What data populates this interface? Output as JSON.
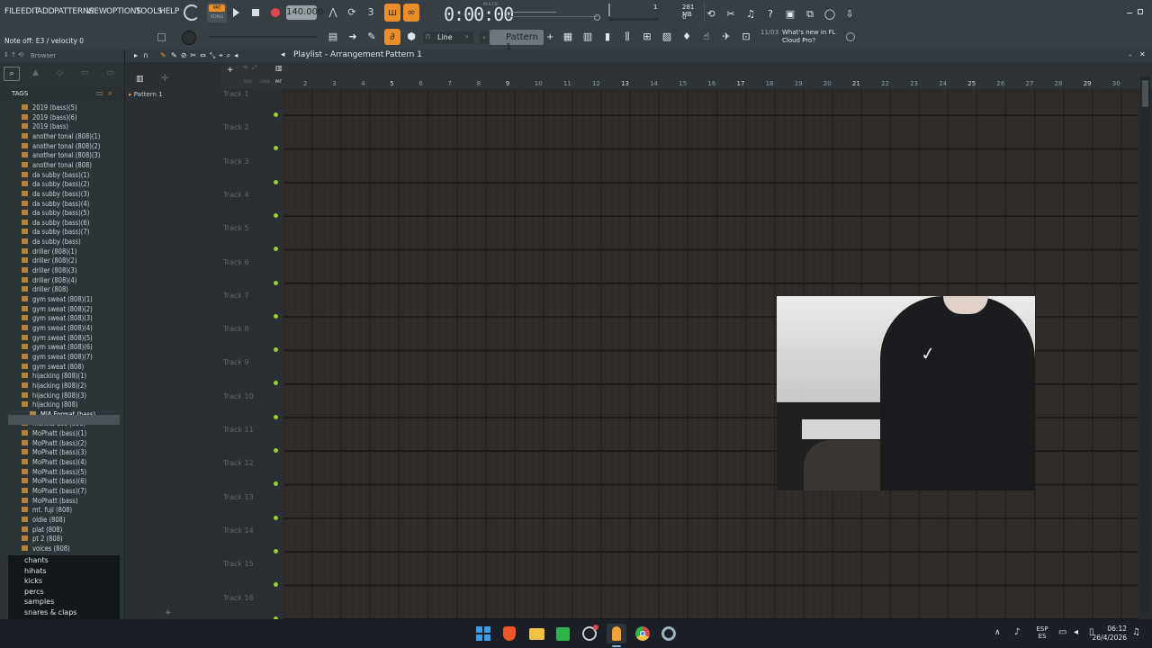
{
  "menu": {
    "items": [
      "FILE",
      "EDIT",
      "ADD",
      "PATTERNS",
      "VIEW",
      "OPTIONS",
      "TOOLS",
      "HELP"
    ]
  },
  "transport": {
    "mode_top": "PAT",
    "mode_bottom": "SONG",
    "tempo": "140.000",
    "time": "0:00:00",
    "time_label": "M:S:CS",
    "cpu_top": "1",
    "cpu_bottom": "0",
    "mem": "281 MB",
    "mem_bottom": "0"
  },
  "hint_bar": "Note off: E3 / velocity 0",
  "snap": "Line",
  "pattern_selector": "Pattern 1",
  "news": {
    "date": "11/03",
    "text": "What's new in FL Cloud Pro?"
  },
  "browser": {
    "title": "Browser",
    "tags_label": "TAGS",
    "items": [
      "2019 (bass)(5)",
      "2019 (bass)(6)",
      "2019 (bass)",
      "another tonal (808)(1)",
      "another tonal (808)(2)",
      "another tonal (808)(3)",
      "another tonal (808)",
      "da subby (bass)(1)",
      "da subby (bass)(2)",
      "da subby (bass)(3)",
      "da subby (bass)(4)",
      "da subby (bass)(5)",
      "da subby (bass)(6)",
      "da subby (bass)(7)",
      "da subby (bass)",
      "driller (808)(1)",
      "driller (808)(2)",
      "driller (808)(3)",
      "driller (808)(4)",
      "driller (808)",
      "gym sweat (808)(1)",
      "gym sweat (808)(2)",
      "gym sweat (808)(3)",
      "gym sweat (808)(4)",
      "gym sweat (808)(5)",
      "gym sweat (808)(6)",
      "gym sweat (808)(7)",
      "gym sweat (808)",
      "hijacking (808)(1)",
      "hijacking (808)(2)",
      "hijacking (808)(3)",
      "hijacking (808)",
      "MIA Format (bass)",
      "monika dos (808)",
      "MoPhatt (bass)(1)",
      "MoPhatt (bass)(2)",
      "MoPhatt (bass)(3)",
      "MoPhatt (bass)(4)",
      "MoPhatt (bass)(5)",
      "MoPhatt (bass)(6)",
      "MoPhatt (bass)(7)",
      "MoPhatt (bass)",
      "mt. fuji (808)",
      "oldie (808)",
      "plat (808)",
      "pt 2 (808)",
      "voices (808)"
    ],
    "folders": [
      "chants",
      "hihats",
      "kicks",
      "percs",
      "samples",
      "snares & claps"
    ]
  },
  "playlist": {
    "title": "Playlist - Arrangement",
    "pattern": "Pattern 1",
    "pattern_list": [
      "Pattern 1"
    ],
    "tracks": [
      "Track 1",
      "Track 2",
      "Track 3",
      "Track 4",
      "Track 5",
      "Track 6",
      "Track 7",
      "Track 8",
      "Track 9",
      "Track 10",
      "Track 11",
      "Track 12",
      "Track 13",
      "Track 14",
      "Track 15",
      "Track 16"
    ],
    "bars": [
      "2",
      "3",
      "4",
      "5",
      "6",
      "7",
      "8",
      "9",
      "10",
      "11",
      "12",
      "13",
      "14",
      "15",
      "16",
      "17",
      "18",
      "19",
      "20",
      "21",
      "22",
      "23",
      "24",
      "25",
      "26",
      "27",
      "28",
      "29",
      "30"
    ],
    "header_labels": [
      "MIDI",
      "CHAN",
      "PAT"
    ]
  },
  "taskbar": {
    "lang_top": "ESP",
    "lang_bottom": "ES",
    "time": "06:12",
    "date": "26/4/2026"
  },
  "colors": {
    "accent": "#e98e2a",
    "track_dot": "#9ccc3c",
    "grid_bg": "#272b2f"
  }
}
